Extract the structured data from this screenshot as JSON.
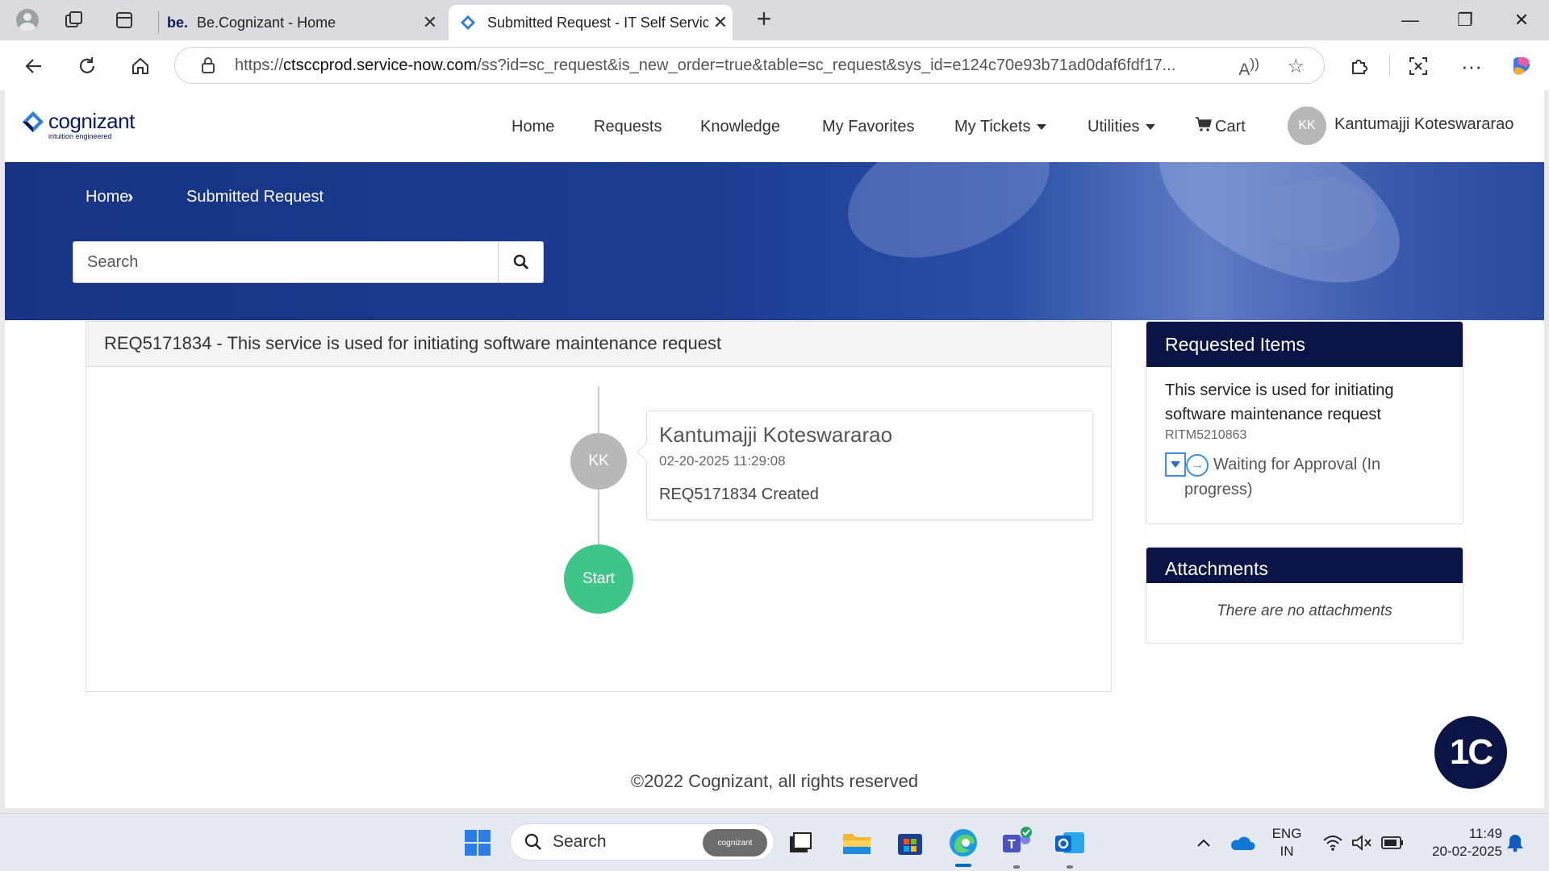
{
  "browser": {
    "tabs": [
      {
        "favicon": "be.",
        "title": "Be.Cognizant - Home",
        "close": "✕"
      },
      {
        "favicon": "cognizant-logo-icon",
        "title": "Submitted Request - IT Self Servic",
        "close": "✕"
      }
    ],
    "new_tab": "+",
    "url_prefix": "https://",
    "url_domain": "ctsccprod.service-now.com",
    "url_path": "/ss?id=sc_request&is_new_order=true&table=sc_request&sys_id=e124c70e93b71ad0daf6fdf17..."
  },
  "site": {
    "logo_name": "cognizant",
    "logo_tagline": "intuition engineered",
    "nav": {
      "home": "Home",
      "requests": "Requests",
      "knowledge": "Knowledge",
      "favorites": "My Favorites",
      "tickets": "My Tickets",
      "utilities": "Utilities",
      "cart": "Cart"
    },
    "user_initials": "KK",
    "user_name": "Kantumajji Koteswararao"
  },
  "hero": {
    "breadcrumb_home": "Home",
    "breadcrumb_current": "Submitted Request",
    "search_placeholder": "Search"
  },
  "request": {
    "header": "REQ5171834 - This service is used for initiating software maintenance request",
    "event": {
      "initials": "KK",
      "name": "Kantumajji Koteswararao",
      "timestamp": "02-20-2025 11:29:08",
      "text": "REQ5171834 Created"
    },
    "start_label": "Start"
  },
  "requested_items": {
    "title": "Requested Items",
    "item_title": "This service is used for initiating software maintenance request",
    "item_number": "RITM5210863",
    "status": "Waiting for Approval (In progress)"
  },
  "attachments": {
    "title": "Attachments",
    "empty_text": "There are no attachments"
  },
  "footer": "©2022 Cognizant, all rights reserved",
  "chat_widget": "1C",
  "taskbar": {
    "search_label": "Search",
    "search_pill": "cognizant",
    "lang_top": "ENG",
    "lang_bottom": "IN",
    "time": "11:49",
    "date": "20-02-2025"
  },
  "colors": {
    "brand_navy": "#0a1545",
    "hero_blue": "#1c3c92",
    "start_green": "#3fc589",
    "link_blue": "#3d8ee0"
  }
}
